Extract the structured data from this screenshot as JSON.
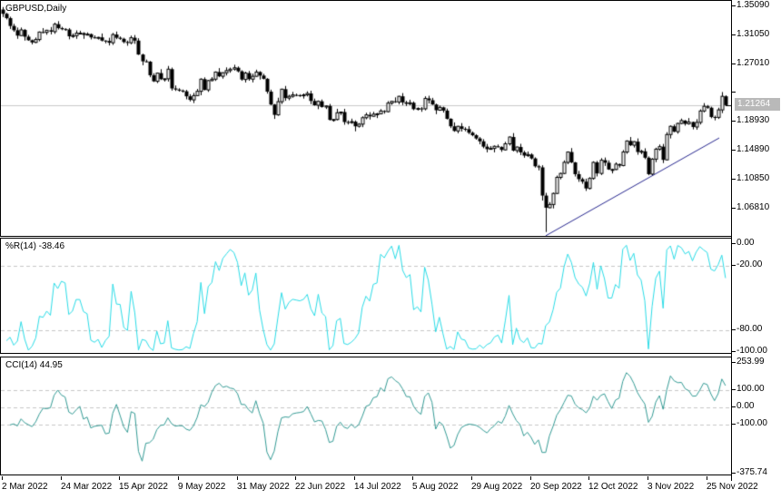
{
  "window": {
    "title": "GBPUSD,Daily"
  },
  "colors": {
    "background": "#ffffff",
    "frame": "#000000",
    "bull_body": "#ffffff",
    "bear_body": "#000000",
    "wick": "#000000",
    "grid_dashed": "#c6c6c6",
    "current_price_line": "#c9c9c9",
    "price_box_bg": "#b9b9b9",
    "price_box_text": "#ffffff",
    "wpr_line": "#29dbe6",
    "cci_line": "#339a94",
    "trendline": "#26268e"
  },
  "chart_data": [
    {
      "id": "main",
      "type": "candlestick",
      "symbol": "GBPUSD",
      "timeframe": "Daily",
      "title": "GBPUSD,Daily",
      "ylim": [
        1.027,
        1.3586
      ],
      "grid": false,
      "y_ticks": [
        {
          "label": "1.35090",
          "price": 1.3509
        },
        {
          "label": "1.31050",
          "price": 1.3105
        },
        {
          "label": "1.27010",
          "price": 1.2701
        },
        {
          "label": "",
          "price": 1.2297
        },
        {
          "label": "1.18930",
          "price": 1.1893
        },
        {
          "label": "1.14890",
          "price": 1.1489
        },
        {
          "label": "1.10850",
          "price": 1.1085
        },
        {
          "label": "1.06810",
          "price": 1.0681
        }
      ],
      "current_price": {
        "label": "1.21264",
        "value": 1.21264
      },
      "trendline": {
        "start_index": 148,
        "start_price": 1.0297,
        "end_index": 195.3,
        "end_price": 1.1667
      },
      "candles": {
        "first_open": 1.3465,
        "closes": [
          1.3405,
          1.3345,
          1.3235,
          1.3175,
          1.31,
          1.318,
          1.3085,
          1.3035,
          1.3005,
          1.3045,
          1.315,
          1.3145,
          1.3175,
          1.3155,
          1.326,
          1.3205,
          1.319,
          1.3185,
          1.309,
          1.31,
          1.3135,
          1.3135,
          1.311,
          1.312,
          1.3075,
          1.307,
          1.3075,
          1.303,
          1.3025,
          1.3,
          1.3115,
          1.307,
          1.3055,
          1.301,
          1.3,
          1.307,
          1.303,
          1.2835,
          1.274,
          1.2735,
          1.2545,
          1.246,
          1.2575,
          1.249,
          1.2495,
          1.263,
          1.236,
          1.2345,
          1.233,
          1.232,
          1.225,
          1.22,
          1.226,
          1.232,
          1.249,
          1.234,
          1.247,
          1.249,
          1.259,
          1.253,
          1.258,
          1.261,
          1.263,
          1.265,
          1.26,
          1.2485,
          1.2575,
          1.249,
          1.253,
          1.259,
          1.254,
          1.2495,
          1.2315,
          1.2135,
          1.199,
          1.2175,
          1.235,
          1.2225,
          1.225,
          1.227,
          1.2265,
          1.226,
          1.227,
          1.229,
          1.2185,
          1.2125,
          1.218,
          1.21,
          1.2115,
          1.192,
          1.1925,
          1.202,
          1.203,
          1.189,
          1.1885,
          1.1895,
          1.183,
          1.186,
          1.195,
          1.199,
          1.197,
          1.2,
          1.2005,
          1.2045,
          1.2035,
          1.2155,
          1.218,
          1.217,
          1.225,
          1.2165,
          1.2145,
          1.216,
          1.207,
          1.208,
          1.2075,
          1.222,
          1.2195,
          1.2135,
          1.2055,
          1.2095,
          1.205,
          1.1935,
          1.183,
          1.1765,
          1.183,
          1.1795,
          1.179,
          1.174,
          1.1705,
          1.166,
          1.162,
          1.1545,
          1.151,
          1.152,
          1.155,
          1.154,
          1.15,
          1.1585,
          1.168,
          1.149,
          1.154,
          1.1465,
          1.142,
          1.1435,
          1.138,
          1.127,
          1.1255,
          1.086,
          1.069,
          1.0735,
          1.089,
          1.1115,
          1.117,
          1.1325,
          1.147,
          1.1325,
          1.116,
          1.109,
          1.1055,
          1.096,
          1.11,
          1.1325,
          1.117,
          1.1355,
          1.132,
          1.1225,
          1.1225,
          1.13,
          1.128,
          1.147,
          1.1625,
          1.1565,
          1.1615,
          1.147,
          1.148,
          1.139,
          1.116,
          1.137,
          1.151,
          1.1545,
          1.136,
          1.1715,
          1.183,
          1.1755,
          1.187,
          1.191,
          1.1865,
          1.189,
          1.182,
          1.1885,
          1.2045,
          1.211,
          1.209,
          1.196,
          1.1955,
          1.206,
          1.225,
          1.21264
        ],
        "wick_pattern_pips": [
          12,
          30,
          18,
          45,
          8,
          25,
          38,
          15,
          22,
          55,
          10,
          33,
          20,
          42,
          6,
          28
        ],
        "overrides": {
          "0": {
            "high": 1.35,
            "low": 1.336
          },
          "74": {
            "low": 1.1933
          },
          "96": {
            "low": 1.176
          },
          "147": {
            "low": 1.079
          },
          "148": {
            "low": 1.035
          },
          "159": {
            "low": 1.0925
          },
          "176": {
            "low": 1.1145
          },
          "191": {
            "high": 1.2155
          },
          "196": {
            "high": 1.231
          },
          "197": {
            "high": 1.2265
          }
        }
      }
    },
    {
      "id": "wpr",
      "type": "line",
      "indicator": "Williams %R",
      "period": 14,
      "title": "%R(14) -38.46",
      "current_value": -38.46,
      "ylim": [
        -100,
        0
      ],
      "legend_position": "top-left",
      "y_ticks": [
        {
          "label": "0.00",
          "value": 0,
          "dashed": false
        },
        {
          "label": "-20.00",
          "value": -20,
          "dashed": true
        },
        {
          "label": "-80.00",
          "value": -80,
          "dashed": true
        },
        {
          "label": "-100.00",
          "value": -100,
          "dashed": false
        }
      ]
    },
    {
      "id": "cci",
      "type": "line",
      "indicator": "CCI",
      "period": 14,
      "title": "CCI(14) 44.95",
      "current_value": 44.95,
      "ylim": [
        -375.74,
        253.99
      ],
      "legend_position": "top-left",
      "y_ticks": [
        {
          "label": "253.99",
          "value": 253.99,
          "dashed": false
        },
        {
          "label": "100.00",
          "value": 100,
          "dashed": true
        },
        {
          "label": "0.00",
          "value": 0,
          "dashed": true
        },
        {
          "label": "-100.00",
          "value": -100,
          "dashed": true
        },
        {
          "label": "-375.74",
          "value": -375.74,
          "dashed": false
        }
      ]
    }
  ],
  "x_axis": {
    "labels": [
      {
        "label": "2 Mar 2022",
        "index": 0
      },
      {
        "label": "24 Mar 2022",
        "index": 16
      },
      {
        "label": "15 Apr 2022",
        "index": 32
      },
      {
        "label": "9 May 2022",
        "index": 48
      },
      {
        "label": "31 May 2022",
        "index": 64
      },
      {
        "label": "22 Jun 2022",
        "index": 80
      },
      {
        "label": "14 Jul 2022",
        "index": 96
      },
      {
        "label": "5 Aug 2022",
        "index": 112
      },
      {
        "label": "29 Aug 2022",
        "index": 128
      },
      {
        "label": "20 Sep 2022",
        "index": 144
      },
      {
        "label": "12 Oct 2022",
        "index": 160
      },
      {
        "label": "3 Nov 2022",
        "index": 176
      },
      {
        "label": "25 Nov 2022",
        "index": 192
      }
    ]
  }
}
